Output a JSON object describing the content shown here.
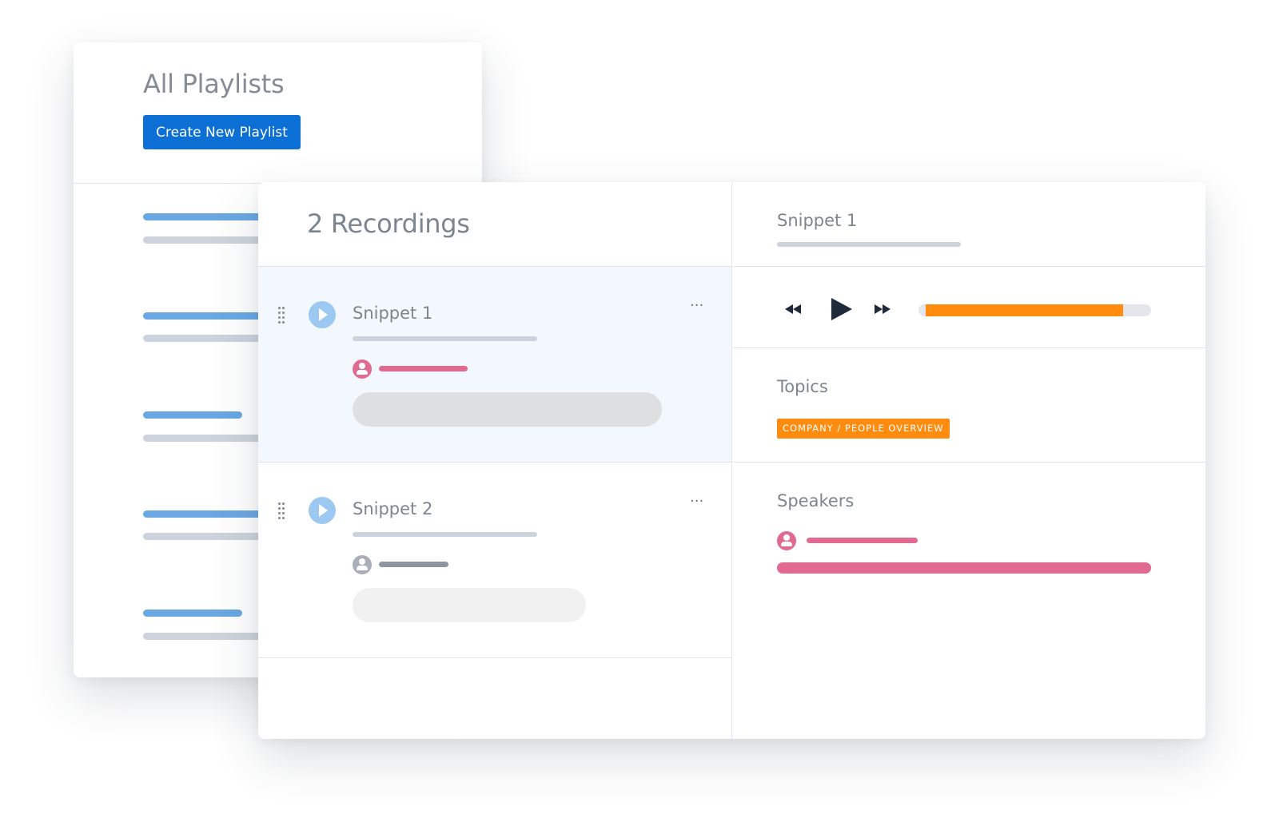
{
  "playlists": {
    "title": "All Playlists",
    "create_button": "Create New Playlist"
  },
  "recordings": {
    "title": "2 Recordings",
    "snippets": [
      {
        "label": "Snippet 1",
        "more": "···"
      },
      {
        "label": "Snippet 2",
        "more": "···"
      }
    ]
  },
  "detail": {
    "title": "Snippet 1",
    "player": {
      "progress_percent": 87
    },
    "topics": {
      "label": "Topics",
      "badge": "COMPANY / PEOPLE OVERVIEW"
    },
    "speakers": {
      "label": "Speakers"
    }
  },
  "colors": {
    "brand_blue": "#0c6fd6",
    "accent_orange": "#ff8b0f",
    "speaker_pink": "#e06a90",
    "placeholder_blue": "#6aa8e3",
    "placeholder_gray": "#ccd3dc"
  }
}
